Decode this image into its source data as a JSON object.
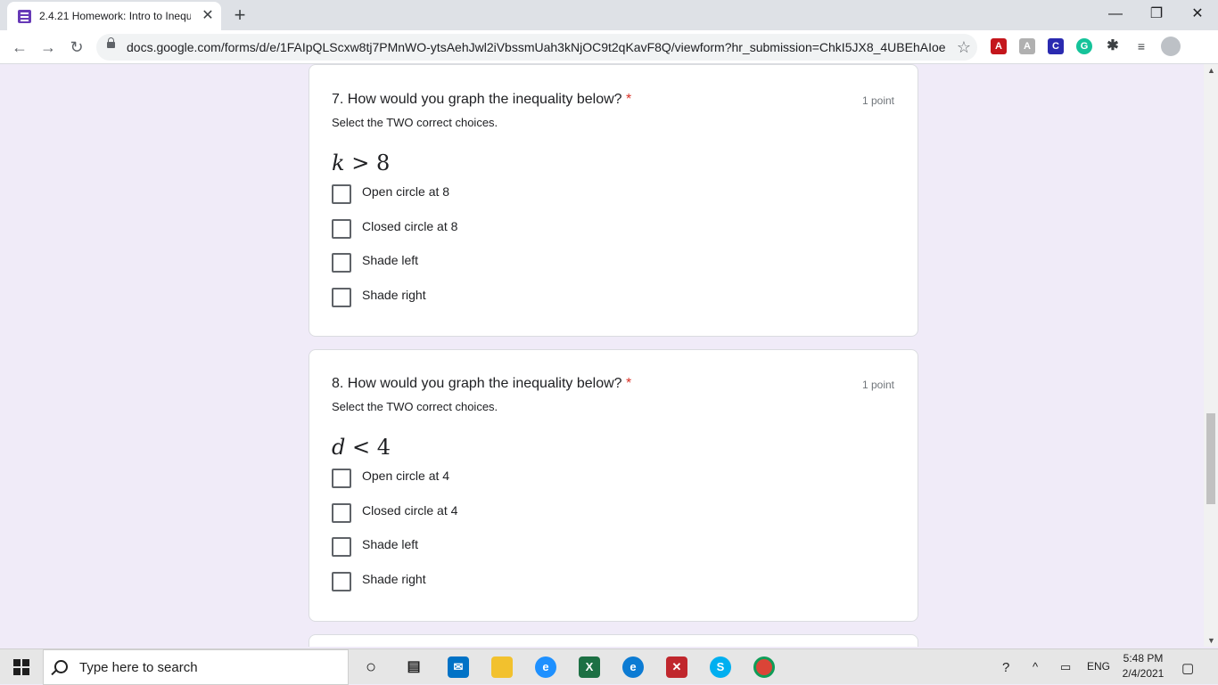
{
  "browser": {
    "tab_title": "2.4.21 Homework: Intro to Inequalities",
    "tab_close": "✕",
    "new_tab": "+",
    "url": "docs.google.com/forms/d/e/1FAIpQLScxw8tj7PMnWO-ytsAehJwl2iVbssmUah3kNjOC9t2qKavF8Q/viewform?hr_submission=ChkI5JX8_4UBEhAIoee...",
    "window_controls": {
      "minimize": "—",
      "maximize": "❐",
      "close": "✕"
    }
  },
  "form": {
    "required_mark": "*",
    "questions": [
      {
        "title": "7. How would you graph the inequality below?",
        "points": "1 point",
        "description": "Select the TWO correct choices.",
        "expression": {
          "variable": "k",
          "operator": ">",
          "value": "8"
        },
        "options": [
          "Open circle at 8",
          "Closed circle at 8",
          "Shade left",
          "Shade right"
        ]
      },
      {
        "title": "8. How would you graph the inequality below?",
        "points": "1 point",
        "description": "Select the TWO correct choices.",
        "expression": {
          "variable": "d",
          "operator": "<",
          "value": "4"
        },
        "options": [
          "Open circle at 4",
          "Closed circle at 4",
          "Shade left",
          "Shade right"
        ]
      }
    ]
  },
  "taskbar": {
    "search_placeholder": "Type here to search",
    "language": "ENG",
    "time": "5:48 PM",
    "date": "2/4/2021"
  }
}
